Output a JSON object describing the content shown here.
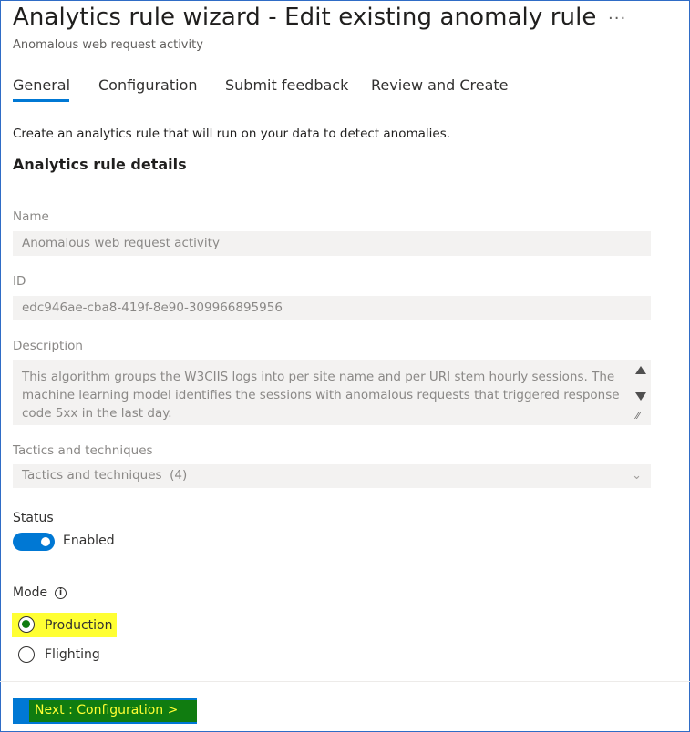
{
  "header": {
    "title": "Analytics rule wizard - Edit existing anomaly rule",
    "subtitle": "Anomalous web request activity",
    "more_icon": "more-horizontal-icon",
    "more_glyph": "···"
  },
  "tabs": [
    {
      "label": "General",
      "selected": true
    },
    {
      "label": "Configuration",
      "selected": false
    },
    {
      "label": "Submit feedback",
      "selected": false
    },
    {
      "label": "Review and Create",
      "selected": false
    }
  ],
  "intro_text": "Create an analytics rule that will run on your data to detect anomalies.",
  "section_title": "Analytics rule details",
  "fields": {
    "name": {
      "label": "Name",
      "value": "Anomalous web request activity"
    },
    "id": {
      "label": "ID",
      "value": "edc946ae-cba8-419f-8e90-309966895956"
    },
    "description": {
      "label": "Description",
      "value": "This algorithm groups the W3CIIS logs into per site name and per URI stem hourly sessions. The machine learning model identifies the sessions with anomalous requests that triggered response code 5xx in the last day."
    },
    "tactics": {
      "label": "Tactics and techniques",
      "value": "Tactics and techniques  (4)"
    }
  },
  "status": {
    "label": "Status",
    "toggle_text": "Enabled",
    "enabled": true
  },
  "mode": {
    "label": "Mode",
    "info_glyph": "i",
    "options": [
      {
        "label": "Production",
        "selected": true
      },
      {
        "label": "Flighting",
        "selected": false
      }
    ]
  },
  "footer": {
    "next_label": "Next : Configuration >"
  },
  "colors": {
    "accent": "#0078d4",
    "highlight_yellow": "#ffff33",
    "highlight_green": "#107c10",
    "frame_border": "#2f6cc6"
  }
}
